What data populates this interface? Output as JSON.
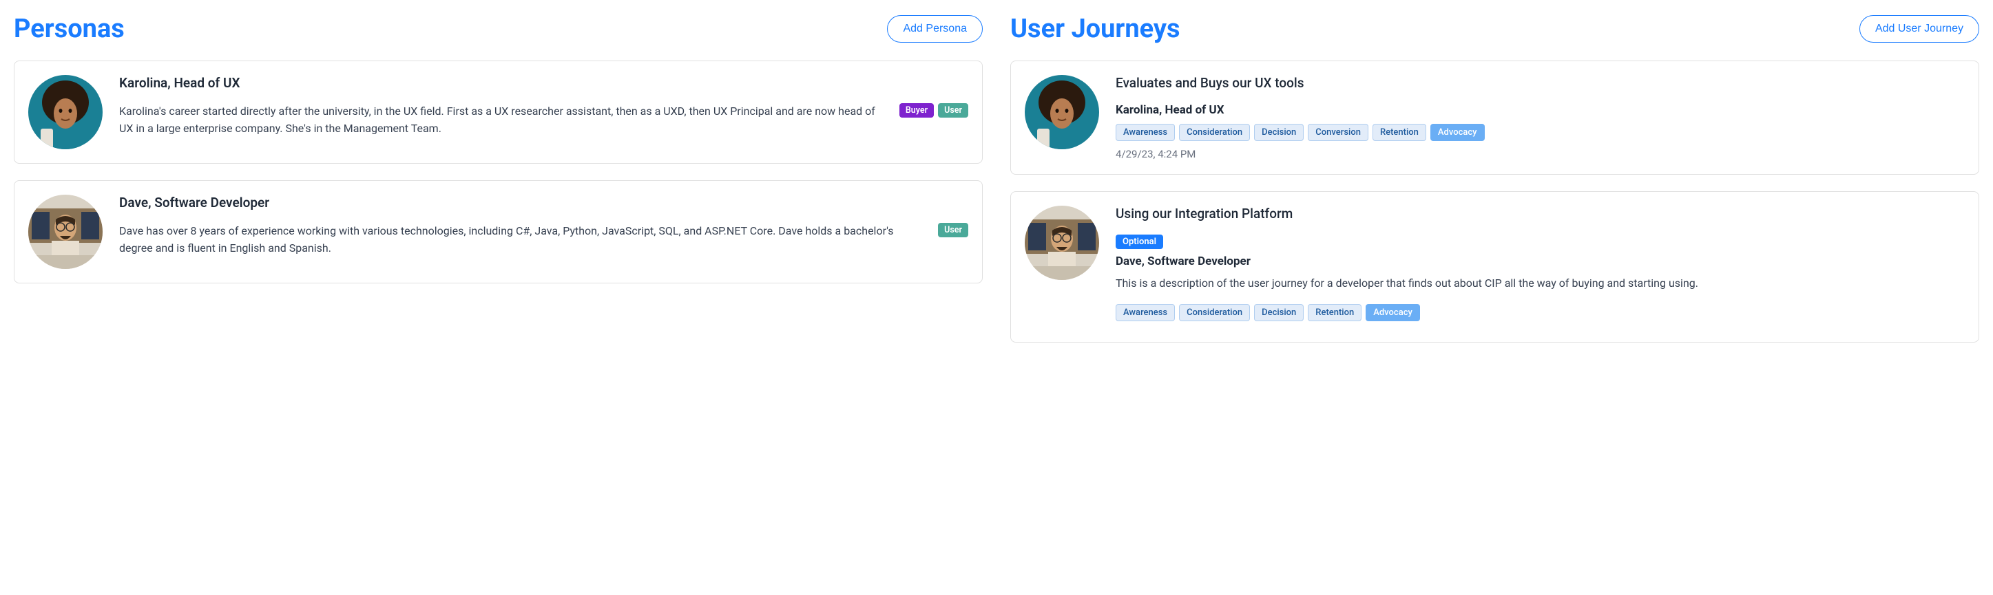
{
  "personas": {
    "title": "Personas",
    "addLabel": "Add Persona",
    "items": [
      {
        "name": "Karolina, Head of UX",
        "desc": "Karolina's career started directly after the university, in the UX field. First as a UX researcher assistant, then as a UXD, then UX Principal and are now head of UX in a large enterprise company. She's in the Management Team.",
        "tags": {
          "buyer": "Buyer",
          "user": "User"
        }
      },
      {
        "name": "Dave, Software Developer",
        "desc": "Dave has over 8 years of experience working with various technologies, including C#, Java, Python, JavaScript, SQL, and ASP.NET Core. Dave holds a bachelor's degree and is fluent in English and Spanish.",
        "tags": {
          "user": "User"
        }
      }
    ]
  },
  "journeys": {
    "title": "User Journeys",
    "addLabel": "Add User Journey",
    "items": [
      {
        "title": "Evaluates and Buys our UX tools",
        "persona": "Karolina, Head of UX",
        "stages": {
          "awareness": "Awareness",
          "consideration": "Consideration",
          "decision": "Decision",
          "conversion": "Conversion",
          "retention": "Retention",
          "advocacy": "Advocacy"
        },
        "timestamp": "4/29/23, 4:24 PM"
      },
      {
        "title": "Using our Integration Platform",
        "optional": "Optional",
        "persona": "Dave, Software Developer",
        "desc": "This is a description of the user journey for a developer that finds out about CIP all the way of buying and starting using.",
        "stages": {
          "awareness": "Awareness",
          "consideration": "Consideration",
          "decision": "Decision",
          "retention": "Retention",
          "advocacy": "Advocacy"
        }
      }
    ]
  }
}
